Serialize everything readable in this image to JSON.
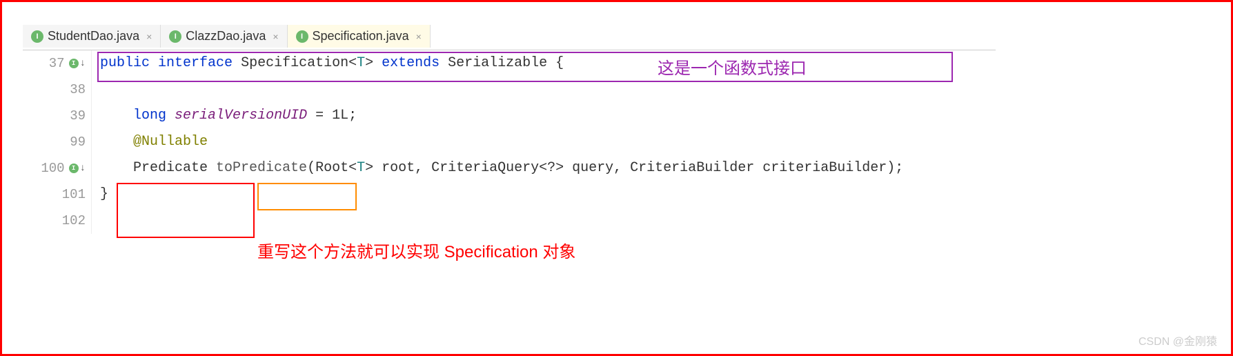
{
  "tabs": [
    {
      "label": "StudentDao.java",
      "icon": "I",
      "active": false
    },
    {
      "label": "ClazzDao.java",
      "icon": "I",
      "active": false
    },
    {
      "label": "Specification.java",
      "icon": "I",
      "active": true
    }
  ],
  "lines": [
    {
      "num": "37",
      "hasIcon": true
    },
    {
      "num": "38",
      "hasIcon": false
    },
    {
      "num": "39",
      "hasIcon": false
    },
    {
      "num": "99",
      "hasIcon": false
    },
    {
      "num": "100",
      "hasIcon": true
    },
    {
      "num": "101",
      "hasIcon": false
    },
    {
      "num": "102",
      "hasIcon": false
    }
  ],
  "code": {
    "l37_public": "public",
    "l37_interface": "interface",
    "l37_name": " Specification<",
    "l37_T": "T",
    "l37_gt": "> ",
    "l37_extends": "extends",
    "l37_rest": " Serializable {",
    "l39_indent": "    ",
    "l39_long": "long",
    "l39_sp": " ",
    "l39_serial": "serialVersionUID",
    "l39_rest": " = 1L;",
    "l99_indent": "    ",
    "l99_anno": "@Nullable",
    "l100_indent": "    Predicate ",
    "l100_method": "toPredicate",
    "l100_open": "(",
    "l100_Root": "Root<",
    "l100_T": "T",
    "l100_afterT": "> root, CriteriaQuery<?> query, CriteriaBuilder criteriaBuilder);",
    "l101": "}"
  },
  "annotations": {
    "purple": "这是一个函数式接口",
    "red": "重写这个方法就可以实现 Specification 对象"
  },
  "watermark": "CSDN @金刚猿"
}
